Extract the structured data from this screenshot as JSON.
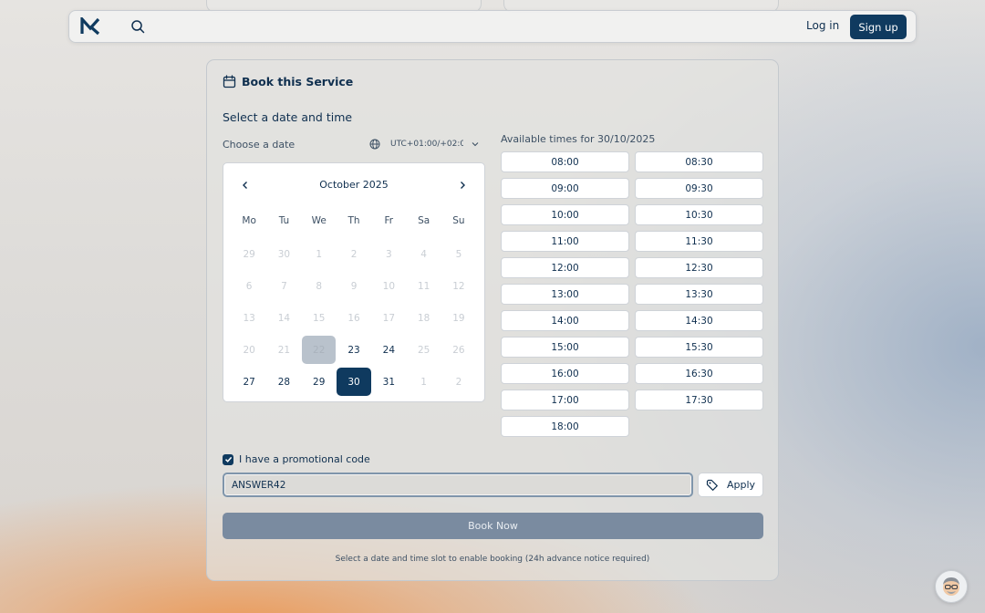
{
  "header": {
    "login_label": "Log in",
    "signup_label": "Sign up"
  },
  "booking": {
    "title": "Book this Service",
    "section_title": "Select a date and time",
    "choose_date_label": "Choose a date",
    "timezone": "UTC+01:00/+02:0..."
  },
  "calendar": {
    "month_label": "October 2025",
    "weekdays": [
      "Mo",
      "Tu",
      "We",
      "Th",
      "Fr",
      "Sa",
      "Su"
    ],
    "days": [
      {
        "n": "29",
        "s": "muted"
      },
      {
        "n": "30",
        "s": "muted"
      },
      {
        "n": "1",
        "s": "past"
      },
      {
        "n": "2",
        "s": "past"
      },
      {
        "n": "3",
        "s": "past"
      },
      {
        "n": "4",
        "s": "past"
      },
      {
        "n": "5",
        "s": "past"
      },
      {
        "n": "6",
        "s": "past"
      },
      {
        "n": "7",
        "s": "past"
      },
      {
        "n": "8",
        "s": "past"
      },
      {
        "n": "9",
        "s": "past"
      },
      {
        "n": "10",
        "s": "past"
      },
      {
        "n": "11",
        "s": "past"
      },
      {
        "n": "12",
        "s": "past"
      },
      {
        "n": "13",
        "s": "past"
      },
      {
        "n": "14",
        "s": "past"
      },
      {
        "n": "15",
        "s": "past"
      },
      {
        "n": "16",
        "s": "past"
      },
      {
        "n": "17",
        "s": "past"
      },
      {
        "n": "18",
        "s": "past"
      },
      {
        "n": "19",
        "s": "past"
      },
      {
        "n": "20",
        "s": "past"
      },
      {
        "n": "21",
        "s": "past"
      },
      {
        "n": "22",
        "s": "today"
      },
      {
        "n": "23",
        "s": "avail"
      },
      {
        "n": "24",
        "s": "avail"
      },
      {
        "n": "25",
        "s": "past"
      },
      {
        "n": "26",
        "s": "past"
      },
      {
        "n": "27",
        "s": "avail"
      },
      {
        "n": "28",
        "s": "avail"
      },
      {
        "n": "29",
        "s": "avail"
      },
      {
        "n": "30",
        "s": "selected"
      },
      {
        "n": "31",
        "s": "avail"
      },
      {
        "n": "1",
        "s": "muted"
      },
      {
        "n": "2",
        "s": "muted"
      }
    ]
  },
  "times": {
    "label": "Available times for 30/10/2025",
    "slots": [
      "08:00",
      "08:30",
      "09:00",
      "09:30",
      "10:00",
      "10:30",
      "11:00",
      "11:30",
      "12:00",
      "12:30",
      "13:00",
      "13:30",
      "14:00",
      "14:30",
      "15:00",
      "15:30",
      "16:00",
      "16:30",
      "17:00",
      "17:30",
      "18:00"
    ]
  },
  "promo": {
    "checkbox_label": "I have a promotional code",
    "checked": true,
    "code_value": "ANSWER42",
    "apply_label": "Apply"
  },
  "book_now_label": "Book Now",
  "hint": "Select a date and time slot to enable booking (24h advance notice required)",
  "colors": {
    "primary": "#0f3a5f",
    "disabled_button": "#7a8ba0"
  }
}
